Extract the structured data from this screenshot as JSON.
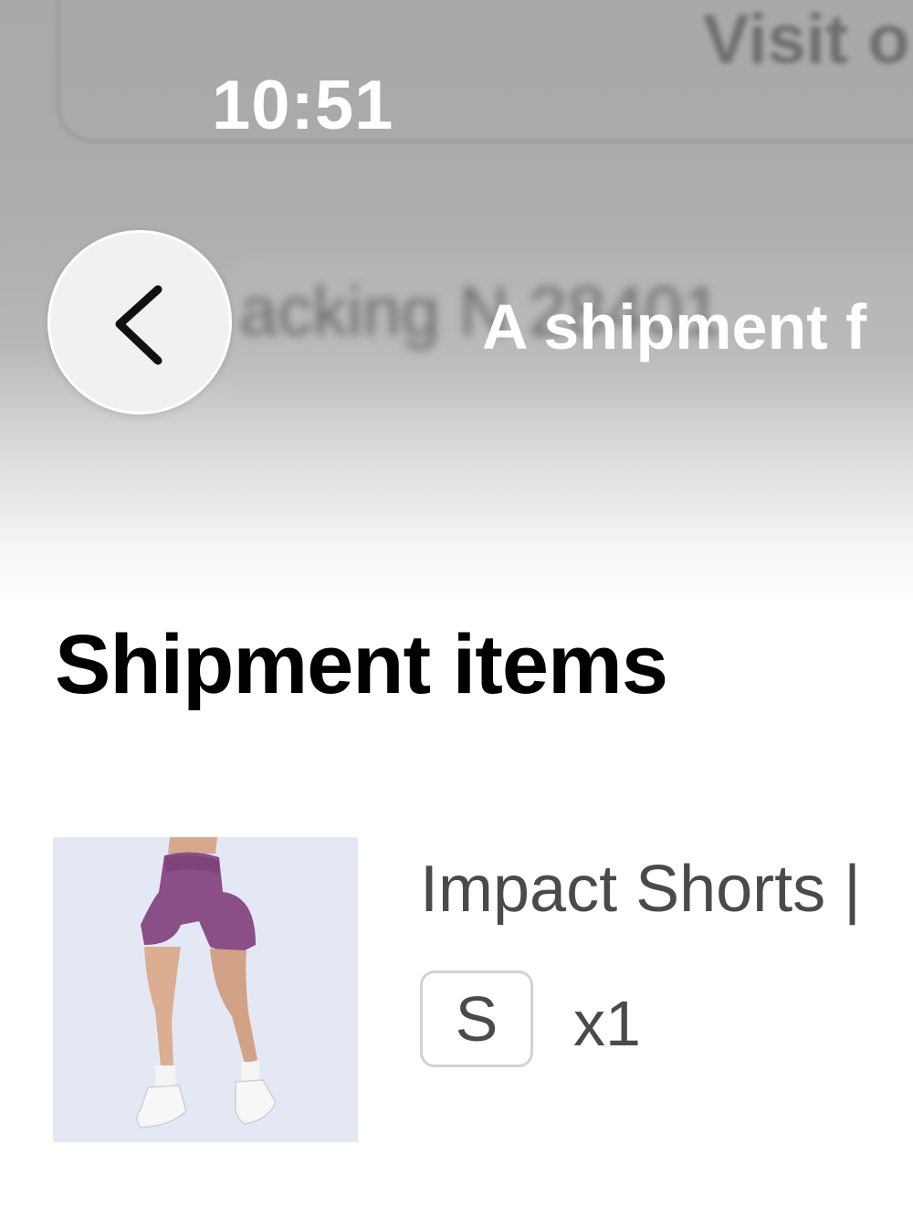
{
  "status_bar": {
    "time": "10:51"
  },
  "background": {
    "visit_text": "Visit o",
    "tracking_text": "acking N 28401"
  },
  "header": {
    "back_icon": "chevron-left-icon",
    "title": "A shipment f"
  },
  "section": {
    "heading": "Shipment items"
  },
  "items": [
    {
      "name": "Impact Shorts |",
      "size": "S",
      "quantity": "x1",
      "image": "product-photo-purple-shorts"
    }
  ],
  "colors": {
    "header_overlay": "#a9a9a9",
    "heading_text": "#000000",
    "body_text": "#4a4a4a",
    "shorts": "#8a4f86"
  }
}
